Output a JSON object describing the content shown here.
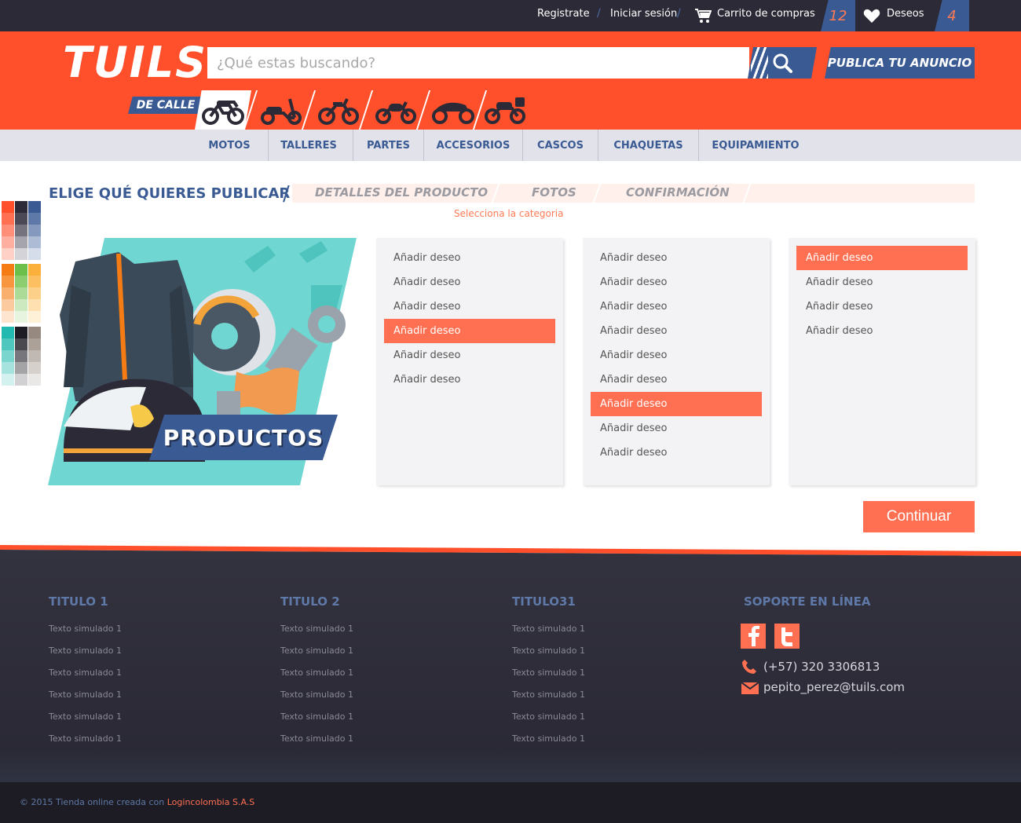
{
  "topbar": {
    "register": "Registrate",
    "login": "Iniciar sesión",
    "cart": "Carrito de compras",
    "cart_count": "12",
    "wishlist": "Deseos",
    "wishlist_count": "4"
  },
  "header": {
    "logo": "TUILS",
    "search_placeholder": "¿Qué estas buscando?",
    "publish": "PUBLICA TU ANUNCIO",
    "category_label": "DE CALLE",
    "moto_icons": [
      "street-motorcycle-icon",
      "scooter-icon",
      "dirt-bike-icon",
      "cruiser-icon",
      "sport-bike-icon",
      "touring-bike-icon"
    ]
  },
  "nav": [
    "MOTOS",
    "TALLERES",
    "PARTES",
    "ACCESORIOS",
    "CASCOS",
    "CHAQUETAS",
    "EQUIPAMIENTO"
  ],
  "steps": {
    "current": "ELIGE QUÉ QUIERES PUBLICAR",
    "items": [
      "DETALLES DEL PRODUCTO",
      "FOTOS",
      "CONFIRMACIÓN"
    ],
    "hint": "Selecciona la categoria"
  },
  "product": {
    "banner": "PRODUCTOS"
  },
  "lists": [
    {
      "items": [
        "Añadir deseo",
        "Añadir deseo",
        "Añadir deseo",
        "Añadir deseo",
        "Añadir deseo",
        "Añadir deseo"
      ],
      "selected": 3
    },
    {
      "items": [
        "Añadir deseo",
        "Añadir deseo",
        "Añadir deseo",
        "Añadir deseo",
        "Añadir deseo",
        "Añadir deseo",
        "Añadir deseo",
        "Añadir deseo",
        "Añadir deseo"
      ],
      "selected": 6
    },
    {
      "items": [
        "Añadir deseo",
        "Añadir deseo",
        "Añadir deseo",
        "Añadir deseo"
      ],
      "selected": 0
    }
  ],
  "continue_label": "Continuar",
  "footer": {
    "columns": [
      {
        "title": "TITULO 1",
        "links": [
          "Texto simulado 1",
          "Texto simulado 1",
          "Texto simulado 1",
          "Texto simulado 1",
          "Texto simulado 1",
          "Texto simulado 1"
        ]
      },
      {
        "title": "TITULO 2",
        "links": [
          "Texto simulado 1",
          "Texto simulado 1",
          "Texto simulado 1",
          "Texto simulado 1",
          "Texto simulado 1",
          "Texto simulado 1"
        ]
      },
      {
        "title": "TITULO31",
        "links": [
          "Texto simulado 1",
          "Texto simulado 1",
          "Texto simulado 1",
          "Texto simulado 1",
          "Texto simulado 1",
          "Texto simulado 1"
        ]
      }
    ],
    "support_title": "SOPORTE EN LÍNEA",
    "phone": "(+57) 320 3306813",
    "email": "pepito_perez@tuils.com",
    "copyright": "© 2015 Tienda online creada con ",
    "copyright_link": "Logincolombia S.A.S"
  },
  "colors": {
    "brand_orange": "#ff4f2b",
    "accent_coral": "#ff6f52",
    "navy": "#3a5a93",
    "dark": "#2b2a36"
  }
}
